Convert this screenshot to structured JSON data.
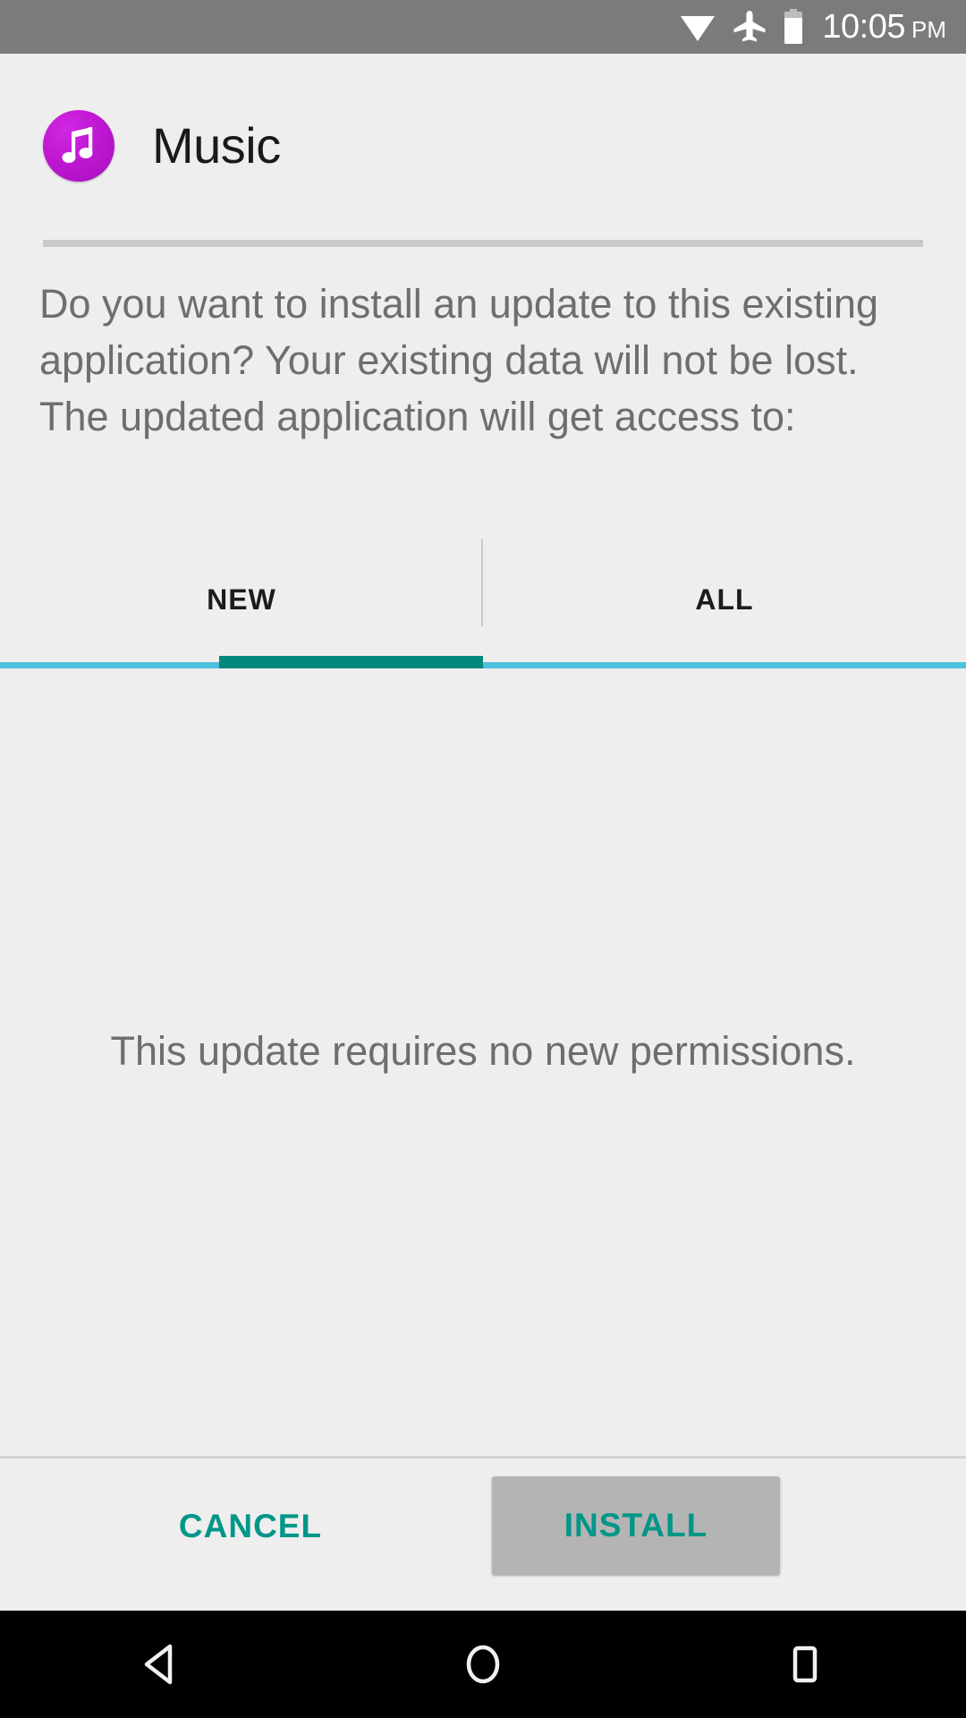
{
  "status_bar": {
    "background_color": "#7b7b7b",
    "icons": [
      "wifi-icon",
      "airplane-mode-icon",
      "battery-icon"
    ],
    "time": "10:05",
    "ampm": "PM"
  },
  "app_header": {
    "icon_name": "music-note-app-icon",
    "icon_color": "#c118d4",
    "title": "Music"
  },
  "dialog": {
    "prompt": "Do you want to install an update to this existing application? Your existing data will not be lost. The updated application will get access to:",
    "permission_message": "This update requires no new permissions."
  },
  "tabs": {
    "active_index": 0,
    "items": [
      {
        "label": "NEW"
      },
      {
        "label": "ALL"
      }
    ],
    "indicator_color": "#00897b",
    "strip_color": "#4ec1dd"
  },
  "actions": {
    "cancel_label": "CANCEL",
    "install_label": "INSTALL",
    "accent_color": "#009688",
    "install_background": "#b4b4b4"
  },
  "nav_bar": {
    "background_color": "#000000",
    "buttons": [
      "back-icon",
      "home-icon",
      "recents-icon"
    ]
  }
}
